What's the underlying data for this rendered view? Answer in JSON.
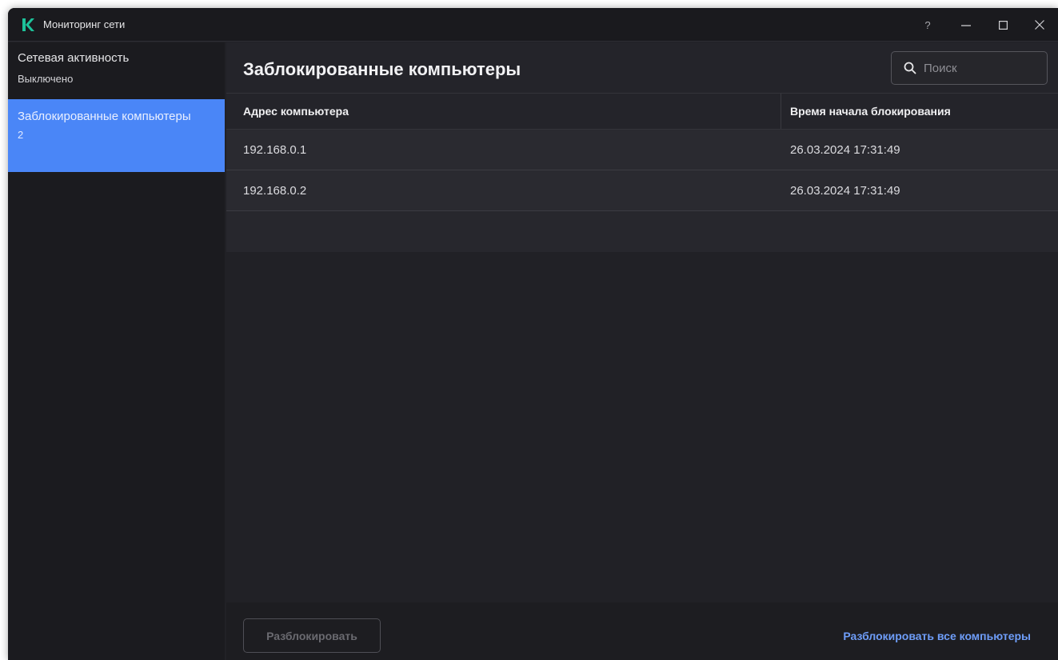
{
  "window": {
    "title": "Мониторинг сети",
    "controls": {
      "help": "?",
      "minimize": "—",
      "maximize": "☐",
      "close": "✕"
    }
  },
  "sidebar": {
    "items": [
      {
        "label": "Сетевая активность",
        "sub": "Выключено",
        "active": false
      },
      {
        "label": "Заблокированные компьютеры",
        "sub": "2",
        "active": true
      }
    ]
  },
  "main": {
    "title": "Заблокированные компьютеры",
    "search": {
      "placeholder": "Поиск"
    },
    "table": {
      "columns": [
        "Адрес компьютера",
        "Время начала блокирования"
      ],
      "rows": [
        [
          "192.168.0.1",
          "26.03.2024 17:31:49"
        ],
        [
          "192.168.0.2",
          "26.03.2024 17:31:49"
        ]
      ]
    }
  },
  "footer": {
    "unblock_label": "Разблокировать",
    "unblock_all_label": "Разблокировать все компьютеры"
  },
  "colors": {
    "accent": "#4a86f7",
    "link": "#6e9df8",
    "logo": "#1dc29a"
  },
  "icons": {
    "logo": "kaspersky-k-icon",
    "search": "search-icon"
  }
}
